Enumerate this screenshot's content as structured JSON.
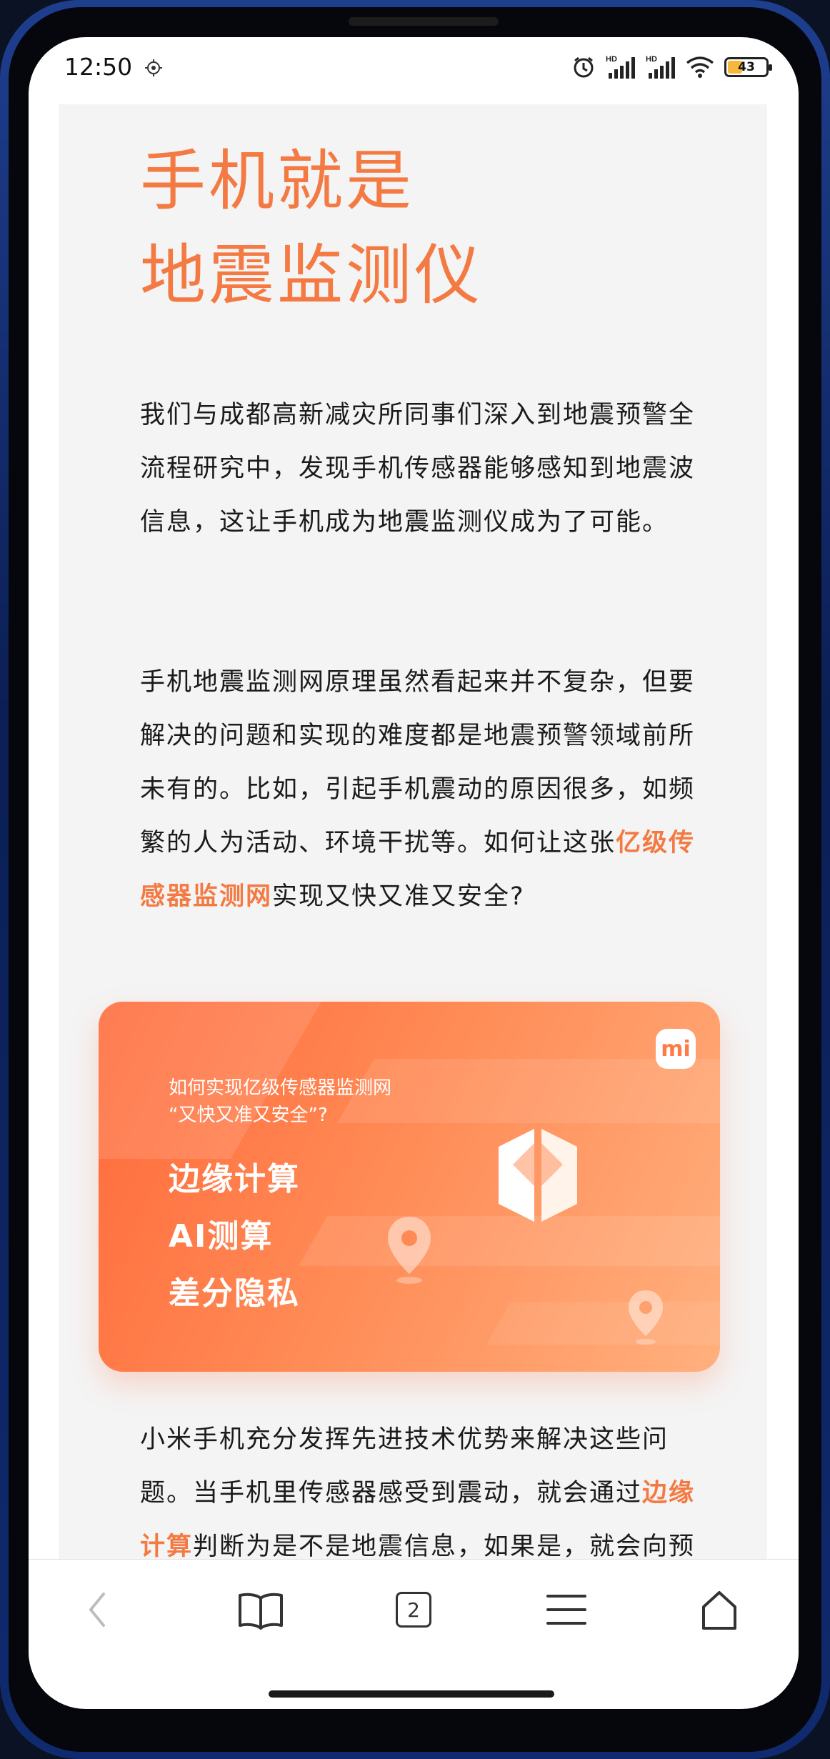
{
  "status_bar": {
    "time": "12:50",
    "left_icon": "gear-status-icon",
    "icons": [
      "alarm-icon",
      "signal-hd-icon",
      "signal-hd-icon",
      "wifi-icon"
    ],
    "signal_badge": "HD",
    "battery_level": 43,
    "battery_text": "43"
  },
  "article": {
    "title": "手机就是\n地震监测仪",
    "paragraph1": "我们与成都高新减灾所同事们深入到地震预警全流程研究中，发现手机传感器能够感知到地震波信息，这让手机成为地震监测仪成为了可能。",
    "paragraph2_part1": "手机地震监测网原理虽然看起来并不复杂，但要解决的问题和实现的难度都是地震预警领域前所未有的。比如，引起手机震动的原因很多，如频繁的人为活动、环境干扰等。如何让这张",
    "paragraph2_highlight": "亿级传感器监测网",
    "paragraph2_part2": "实现又快又准又安全?",
    "paragraph3_part1": "小米手机充分发挥先进技术优势来解决这些问题。当手机里传感器感受到震动，就会通过",
    "paragraph3_highlight": "边缘计算",
    "paragraph3_part2": "判断为是不是地震信息，如果是，就会向预"
  },
  "banner": {
    "logo": "mi",
    "subtitle_line1": "如何实现亿级传感器监测网",
    "subtitle_line2": "“又快又准又安全”?",
    "items": [
      "边缘计算",
      "AI测算",
      "差分隐私"
    ],
    "colors": {
      "start": "#ff6a3a",
      "end": "#ffb07e"
    }
  },
  "bottom_nav": {
    "tab_count": "2",
    "icons": [
      "back-icon",
      "bookmarks-icon",
      "tabs-icon",
      "menu-icon",
      "home-icon"
    ]
  },
  "colors": {
    "accent": "#f47a43",
    "text": "#1b1b1b",
    "page_bg": "#f4f4f4"
  }
}
